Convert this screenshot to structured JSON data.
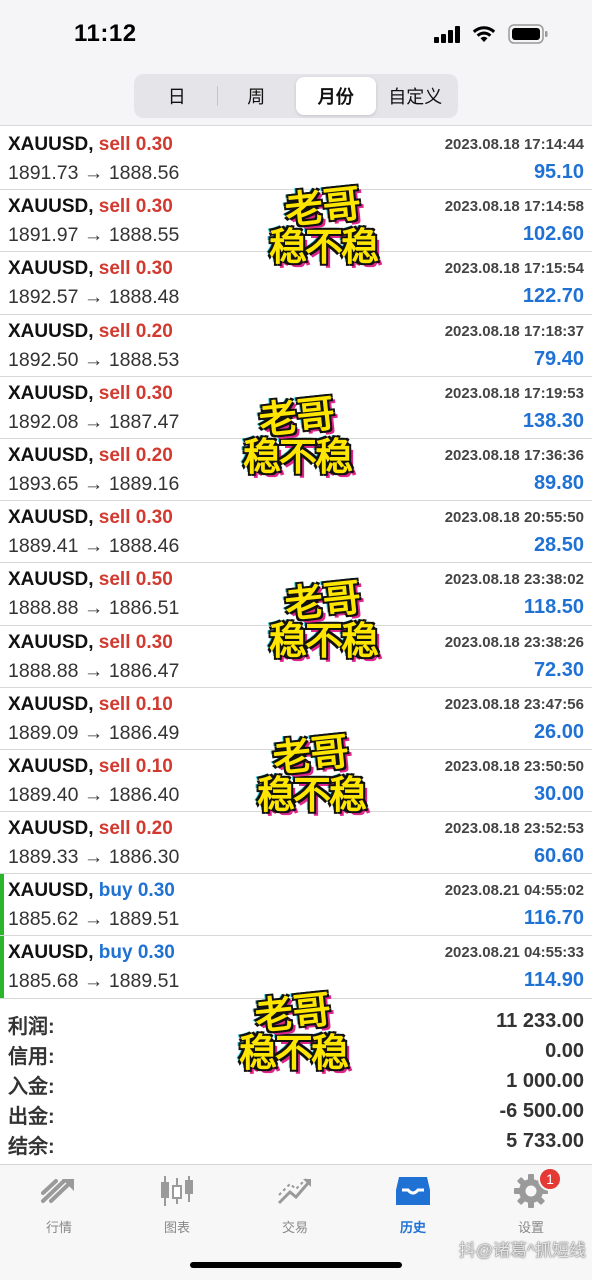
{
  "status_bar": {
    "time": "11:12"
  },
  "period_tabs": [
    {
      "label": "日",
      "active": false
    },
    {
      "label": "周",
      "active": false
    },
    {
      "label": "月份",
      "active": true
    },
    {
      "label": "自定义",
      "active": false
    }
  ],
  "deals": [
    {
      "symbol": "XAUUSD,",
      "side": "sell",
      "volume": "0.30",
      "prices": "1891.73 → 1888.56",
      "datetime": "2023.08.18 17:14:44",
      "profit": "95.10"
    },
    {
      "symbol": "XAUUSD,",
      "side": "sell",
      "volume": "0.30",
      "prices": "1891.97 → 1888.55",
      "datetime": "2023.08.18 17:14:58",
      "profit": "102.60"
    },
    {
      "symbol": "XAUUSD,",
      "side": "sell",
      "volume": "0.30",
      "prices": "1892.57 → 1888.48",
      "datetime": "2023.08.18 17:15:54",
      "profit": "122.70"
    },
    {
      "symbol": "XAUUSD,",
      "side": "sell",
      "volume": "0.20",
      "prices": "1892.50 → 1888.53",
      "datetime": "2023.08.18 17:18:37",
      "profit": "79.40"
    },
    {
      "symbol": "XAUUSD,",
      "side": "sell",
      "volume": "0.30",
      "prices": "1892.08 → 1887.47",
      "datetime": "2023.08.18 17:19:53",
      "profit": "138.30"
    },
    {
      "symbol": "XAUUSD,",
      "side": "sell",
      "volume": "0.20",
      "prices": "1893.65 → 1889.16",
      "datetime": "2023.08.18 17:36:36",
      "profit": "89.80"
    },
    {
      "symbol": "XAUUSD,",
      "side": "sell",
      "volume": "0.30",
      "prices": "1889.41 → 1888.46",
      "datetime": "2023.08.18 20:55:50",
      "profit": "28.50"
    },
    {
      "symbol": "XAUUSD,",
      "side": "sell",
      "volume": "0.50",
      "prices": "1888.88 → 1886.51",
      "datetime": "2023.08.18 23:38:02",
      "profit": "118.50"
    },
    {
      "symbol": "XAUUSD,",
      "side": "sell",
      "volume": "0.30",
      "prices": "1888.88 → 1886.47",
      "datetime": "2023.08.18 23:38:26",
      "profit": "72.30"
    },
    {
      "symbol": "XAUUSD,",
      "side": "sell",
      "volume": "0.10",
      "prices": "1889.09 → 1886.49",
      "datetime": "2023.08.18 23:47:56",
      "profit": "26.00"
    },
    {
      "symbol": "XAUUSD,",
      "side": "sell",
      "volume": "0.10",
      "prices": "1889.40 → 1886.40",
      "datetime": "2023.08.18 23:50:50",
      "profit": "30.00"
    },
    {
      "symbol": "XAUUSD,",
      "side": "sell",
      "volume": "0.20",
      "prices": "1889.33 → 1886.30",
      "datetime": "2023.08.18 23:52:53",
      "profit": "60.60"
    },
    {
      "symbol": "XAUUSD,",
      "side": "buy",
      "volume": "0.30",
      "prices": "1885.62 → 1889.51",
      "datetime": "2023.08.21 04:55:02",
      "profit": "116.70"
    },
    {
      "symbol": "XAUUSD,",
      "side": "buy",
      "volume": "0.30",
      "prices": "1885.68 → 1889.51",
      "datetime": "2023.08.21 04:55:33",
      "profit": "114.90"
    }
  ],
  "summary": [
    {
      "label": "利润:",
      "value": "11 233.00"
    },
    {
      "label": "信用:",
      "value": "0.00"
    },
    {
      "label": "入金:",
      "value": "1 000.00"
    },
    {
      "label": "出金:",
      "value": "-6 500.00"
    },
    {
      "label": "结余:",
      "value": "5 733.00"
    }
  ],
  "tabbar": [
    {
      "label": "行情",
      "icon": "quotes-icon",
      "active": false
    },
    {
      "label": "图表",
      "icon": "chart-icon",
      "active": false
    },
    {
      "label": "交易",
      "icon": "trade-icon",
      "active": false
    },
    {
      "label": "历史",
      "icon": "history-icon",
      "active": true
    },
    {
      "label": "设置",
      "icon": "settings-icon",
      "active": false,
      "badge": "1"
    }
  ],
  "stickers": [
    {
      "line1": "老哥",
      "line2": "稳不稳"
    },
    {
      "line1": "老哥",
      "line2": "稳不稳"
    },
    {
      "line1": "老哥",
      "line2": "稳不稳"
    },
    {
      "line1": "老哥",
      "line2": "稳不稳"
    },
    {
      "line1": "老哥",
      "line2": "稳不稳"
    }
  ],
  "watermark": "抖@诸葛^抓短线",
  "colors": {
    "sell": "#d23a2f",
    "buy_side": "#1f72d4",
    "profit": "#1f72d4",
    "buy_marker": "#2bb52b",
    "active_tab": "#1f72d4",
    "badge": "#e53935"
  }
}
